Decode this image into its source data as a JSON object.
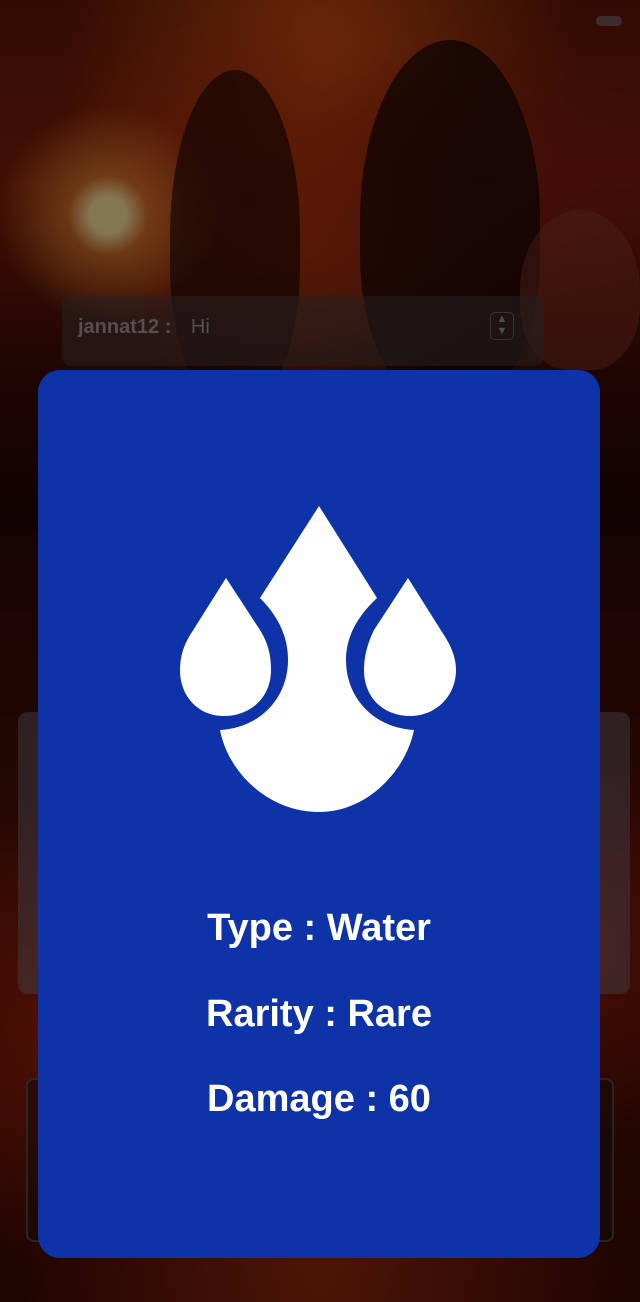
{
  "background": {
    "chat": {
      "username": "jannat12 :",
      "message": "Hi"
    }
  },
  "card": {
    "element_icon": "water-drops-icon",
    "background_color": "#0e32a8",
    "stats": {
      "type": "Type : Water",
      "rarity": "Rarity : Rare",
      "damage": "Damage : 60"
    }
  }
}
